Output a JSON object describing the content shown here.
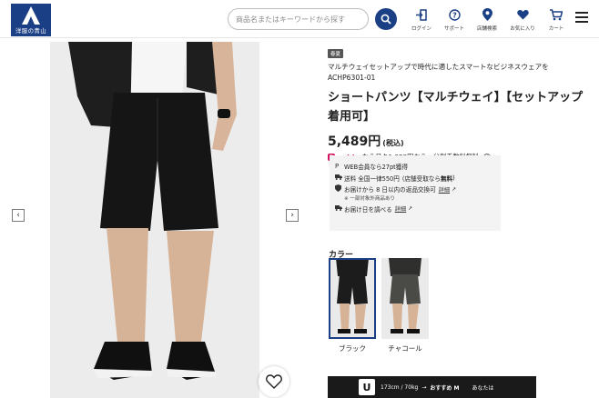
{
  "header": {
    "logo_text": "洋服の青山",
    "search_placeholder": "商品名またはキーワードから探す",
    "nav": [
      {
        "label": "ログイン",
        "icon": "login-icon"
      },
      {
        "label": "サポート",
        "icon": "help-icon"
      },
      {
        "label": "店舗検索",
        "icon": "map-pin-icon"
      },
      {
        "label": "お気に入り",
        "icon": "heart-icon"
      },
      {
        "label": "カート",
        "icon": "cart-icon"
      }
    ]
  },
  "gallery": {
    "prev_arrow": "‹",
    "next_arrow": "›"
  },
  "product": {
    "badge": "春夏",
    "description": "マルチウェイセットアップで時代に適したスマートなビジネスウェアを",
    "code": "ACHP6301-01",
    "title": "ショートパンツ【マルチウェイ】【セットアップ着用可】",
    "price": "5,489円",
    "tax": "(税込)",
    "paidy_brand": "paidy",
    "paidy_text": "なら月々1,829円から。分割手数料無料",
    "benefits": {
      "points": "WEB会員なら27pt獲得",
      "shipping_prefix": "送料 全国一律550円",
      "shipping_suffix": "(店舗受取なら",
      "shipping_free": "無料",
      "shipping_close": ")",
      "return_text": "お届けから 8 日以内の返品交換可",
      "return_link": "詳細",
      "return_note": "※ 一部対象外商品あり",
      "delivery_text": "お届け日を調べる",
      "delivery_link": "詳細"
    },
    "color_label": "カラー",
    "colors": [
      {
        "name": "ブラック",
        "hex": "#1c1c1c"
      },
      {
        "name": "チャコール",
        "hex": "#3b3b38"
      }
    ]
  },
  "fit_bar": {
    "logo": "U",
    "size_info": "173cm / 70kg",
    "arrow": "→",
    "recommend": "おすすめ M",
    "you": "あなたは"
  }
}
